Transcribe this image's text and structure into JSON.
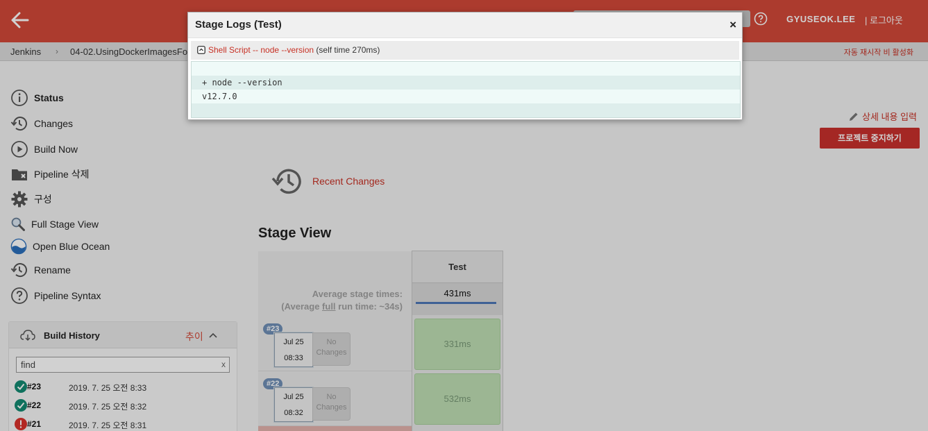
{
  "header": {
    "user": "GYUSEOK.LEE",
    "logout": "| 로그아웃"
  },
  "breadcrumb": {
    "items": [
      "Jenkins",
      "04-02.UsingDockerImagesFo"
    ],
    "right_link": "자동 재시작 비 활성화"
  },
  "sidebar": {
    "items": [
      {
        "label": "Status",
        "icon": "info-icon"
      },
      {
        "label": "Changes",
        "icon": "history-icon"
      },
      {
        "label": "Build Now",
        "icon": "play-icon"
      },
      {
        "label": "Pipeline 삭제",
        "icon": "folder-delete-icon"
      },
      {
        "label": "구성",
        "icon": "gear-icon"
      },
      {
        "label": "Full Stage View",
        "icon": "magnifier-icon"
      },
      {
        "label": "Open Blue Ocean",
        "icon": "blue-ocean-icon"
      },
      {
        "label": "Rename",
        "icon": "history-icon"
      },
      {
        "label": "Pipeline Syntax",
        "icon": "help-icon"
      }
    ]
  },
  "build_history": {
    "title": "Build History",
    "trend": "추이",
    "find_value": "find",
    "find_clear": "x",
    "builds": [
      {
        "num": "#23",
        "date": "2019. 7. 25 오전 8:33",
        "status": "success"
      },
      {
        "num": "#22",
        "date": "2019. 7. 25 오전 8:32",
        "status": "success"
      },
      {
        "num": "#21",
        "date": "2019. 7. 25 오전 8:31",
        "status": "failed"
      }
    ]
  },
  "main": {
    "recent_changes": "Recent Changes",
    "stage_view_title": "Stage View",
    "edit_description": "상세 내용 입력",
    "stop_project": "프로젝트 중지하기"
  },
  "stage_view": {
    "stage_name": "Test",
    "avg_line1": "Average stage times:",
    "avg_line2_pre": "(Average ",
    "avg_line2_u": "full",
    "avg_line2_post": " run time: ~34s)",
    "avg_time": "431ms",
    "runs": [
      {
        "badge": "#23",
        "date": "Jul 25",
        "time": "08:33",
        "changes": "No Changes",
        "stage_time": "331ms"
      },
      {
        "badge": "#22",
        "date": "Jul 25",
        "time": "08:32",
        "changes": "No Changes",
        "stage_time": "532ms"
      }
    ]
  },
  "modal": {
    "title": "Stage Logs (Test)",
    "close": "×",
    "step_link": "Shell Script -- node --version",
    "step_time": " (self time 270ms)",
    "log_lines": [
      "",
      "+ node --version",
      "v12.7.0",
      ""
    ]
  },
  "colors": {
    "header": "#d24939",
    "link": "#c73024",
    "success": "#138a72",
    "failed": "#d9312b",
    "stage_cell": "#bfdfb4"
  }
}
